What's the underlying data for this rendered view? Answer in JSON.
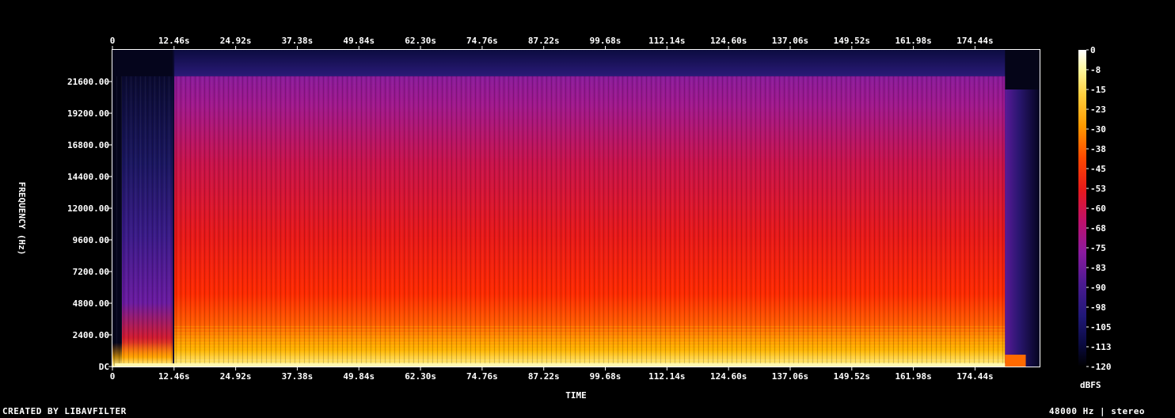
{
  "chart_data": {
    "type": "heatmap",
    "title": "",
    "xlabel": "TIME",
    "ylabel": "FREQUENCY (Hz)",
    "colorbar_label": "dBFS",
    "x_ticks": [
      "0",
      "12.46s",
      "24.92s",
      "37.38s",
      "49.84s",
      "62.30s",
      "74.76s",
      "87.22s",
      "99.68s",
      "112.14s",
      "124.60s",
      "137.06s",
      "149.52s",
      "161.98s",
      "174.44s"
    ],
    "x_tick_values": [
      0,
      12.46,
      24.92,
      37.38,
      49.84,
      62.3,
      74.76,
      87.22,
      99.68,
      112.14,
      124.6,
      137.06,
      149.52,
      161.98,
      174.44
    ],
    "x_range": [
      0,
      187.5
    ],
    "y_ticks": [
      "DC",
      "2400.00",
      "4800.00",
      "7200.00",
      "9600.00",
      "12000.00",
      "14400.00",
      "16800.00",
      "19200.00",
      "21600.00"
    ],
    "y_tick_values": [
      0,
      2400,
      4800,
      7200,
      9600,
      12000,
      14400,
      16800,
      19200,
      21600
    ],
    "y_range": [
      0,
      24000
    ],
    "colorbar_ticks": [
      "0",
      "-8",
      "-15",
      "-23",
      "-30",
      "-38",
      "-45",
      "-53",
      "-60",
      "-68",
      "-75",
      "-83",
      "-90",
      "-98",
      "-105",
      "-113",
      "-120"
    ],
    "colorbar_range": [
      0,
      -120
    ],
    "colors": {
      "scale": [
        "#000000",
        "#0a0a3c",
        "#281880",
        "#4a1a8c",
        "#7a1aa0",
        "#b01580",
        "#dd1030",
        "#ff2a00",
        "#ff7a00",
        "#ffc000",
        "#ffee60",
        "#ffffff"
      ]
    },
    "regions": [
      {
        "t_start": 0,
        "t_end": 12.2,
        "f_max": 22000,
        "intensity": "low"
      },
      {
        "t_start": 12.5,
        "t_end": 180.5,
        "f_max": 22000,
        "intensity": "high"
      },
      {
        "t_start": 180.5,
        "t_end": 187.5,
        "f_max": 21000,
        "intensity": "fade-out"
      }
    ]
  },
  "footer": {
    "left": "CREATED BY LIBAVFILTER",
    "right": "48000 Hz | stereo"
  }
}
